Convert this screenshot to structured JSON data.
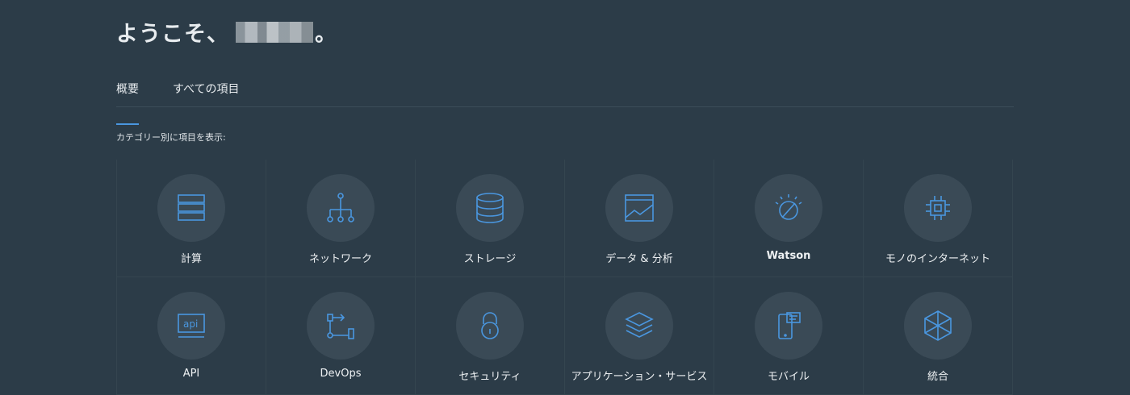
{
  "header": {
    "welcome_prefix": "ようこそ、",
    "welcome_suffix": "。"
  },
  "tabs": [
    {
      "label": "概要",
      "active": true
    },
    {
      "label": "すべての項目",
      "active": false
    }
  ],
  "category_prompt": "カテゴリー別に項目を表示:",
  "tiles_row1": [
    {
      "label": "計算",
      "icon": "server-icon"
    },
    {
      "label": "ネットワーク",
      "icon": "network-icon"
    },
    {
      "label": "ストレージ",
      "icon": "database-icon"
    },
    {
      "label": "データ & 分析",
      "icon": "chart-icon"
    },
    {
      "label": "Watson",
      "icon": "watson-icon"
    },
    {
      "label": "モノのインターネット",
      "icon": "chip-icon"
    }
  ],
  "tiles_row2": [
    {
      "label": "API",
      "icon": "api-icon"
    },
    {
      "label": "DevOps",
      "icon": "devops-icon"
    },
    {
      "label": "セキュリティ",
      "icon": "lock-icon"
    },
    {
      "label": "アプリケーション・サービス",
      "icon": "layers-icon"
    },
    {
      "label": "モバイル",
      "icon": "mobile-icon"
    },
    {
      "label": "統合",
      "icon": "hexagon-icon"
    }
  ],
  "colors": {
    "background": "#2c3c48",
    "accent": "#4a97e0",
    "tile_circle": "#3a4a56"
  }
}
